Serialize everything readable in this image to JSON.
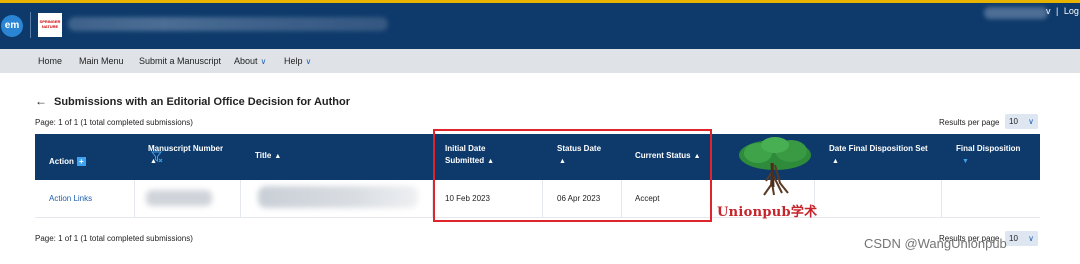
{
  "header": {
    "em_logo": "em",
    "journal_logo_text": "SPRINGER NATURE",
    "user_menu_suffix": "Log",
    "separator": "|",
    "chevron": "v"
  },
  "nav": {
    "items": [
      {
        "label": "Home"
      },
      {
        "label": "Main Menu"
      },
      {
        "label": "Submit a Manuscript"
      },
      {
        "label": "About"
      },
      {
        "label": "Help"
      }
    ]
  },
  "page": {
    "back_arrow": "←",
    "title": "Submissions with an Editorial Office Decision for Author",
    "page_info": "Page: 1 of 1 (1 total completed submissions)",
    "results_per_page_label": "Results per page",
    "results_per_page_value": "10"
  },
  "table": {
    "columns": [
      {
        "label": "Action",
        "sort": "add"
      },
      {
        "label": "Manuscript Number",
        "sort": "up"
      },
      {
        "label": "Title",
        "sort": "up"
      },
      {
        "label": "Initial Date Submitted",
        "sort": "up"
      },
      {
        "label": "Status Date",
        "sort": "up"
      },
      {
        "label": "Current Status",
        "sort": "up"
      },
      {
        "label": "Date Final Disposition Set",
        "sort": "up"
      },
      {
        "label": "Final Disposition",
        "sort": "down"
      }
    ],
    "rows": [
      {
        "action": "Action Links",
        "manuscript_number": "",
        "title": "",
        "initial_date_submitted": "10 Feb 2023",
        "status_date": "06 Apr 2023",
        "current_status": "Accept",
        "date_final_disposition_set": "",
        "final_disposition": ""
      }
    ]
  },
  "overlay": {
    "watermark_text": "Unionpub学术",
    "csdn_text": "CSDN @WangUnionpub"
  },
  "colors": {
    "header_bg": "#0e3a6b",
    "nav_bg": "#dfe3e8",
    "accent_blue": "#3fa2ee",
    "highlight_red": "#e0242b"
  }
}
